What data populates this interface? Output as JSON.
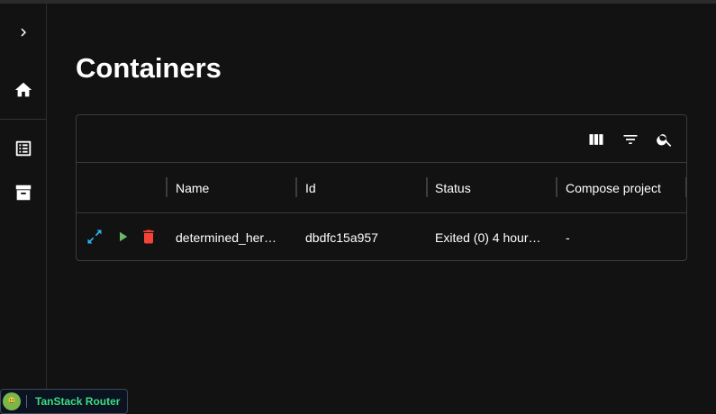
{
  "page": {
    "title": "Containers"
  },
  "sidebar": {
    "items": [
      {
        "icon": "chevron-right-icon"
      },
      {
        "icon": "home-icon"
      },
      {
        "icon": "list-icon"
      },
      {
        "icon": "archive-icon"
      }
    ]
  },
  "toolbar": {
    "buttons": [
      {
        "icon": "columns-icon"
      },
      {
        "icon": "filter-icon"
      },
      {
        "icon": "search-icon"
      }
    ]
  },
  "table": {
    "columns": [
      "Name",
      "Id",
      "Status",
      "Compose project"
    ],
    "rows": [
      {
        "name": "determined_her…",
        "id": "dbdfc15a957",
        "status": "Exited (0) 4 hour…",
        "compose_project": "-"
      }
    ],
    "row_actions": [
      {
        "icon": "expand-icon",
        "color": "#29b6f6"
      },
      {
        "icon": "play-icon",
        "color": "#66bb6a"
      },
      {
        "icon": "delete-icon",
        "color": "#f44336"
      }
    ]
  },
  "devtools": {
    "label": "TanStack Router"
  },
  "colors": {
    "background": "#121212",
    "border": "#3a3a3a",
    "accent_green": "#3ddc84"
  }
}
